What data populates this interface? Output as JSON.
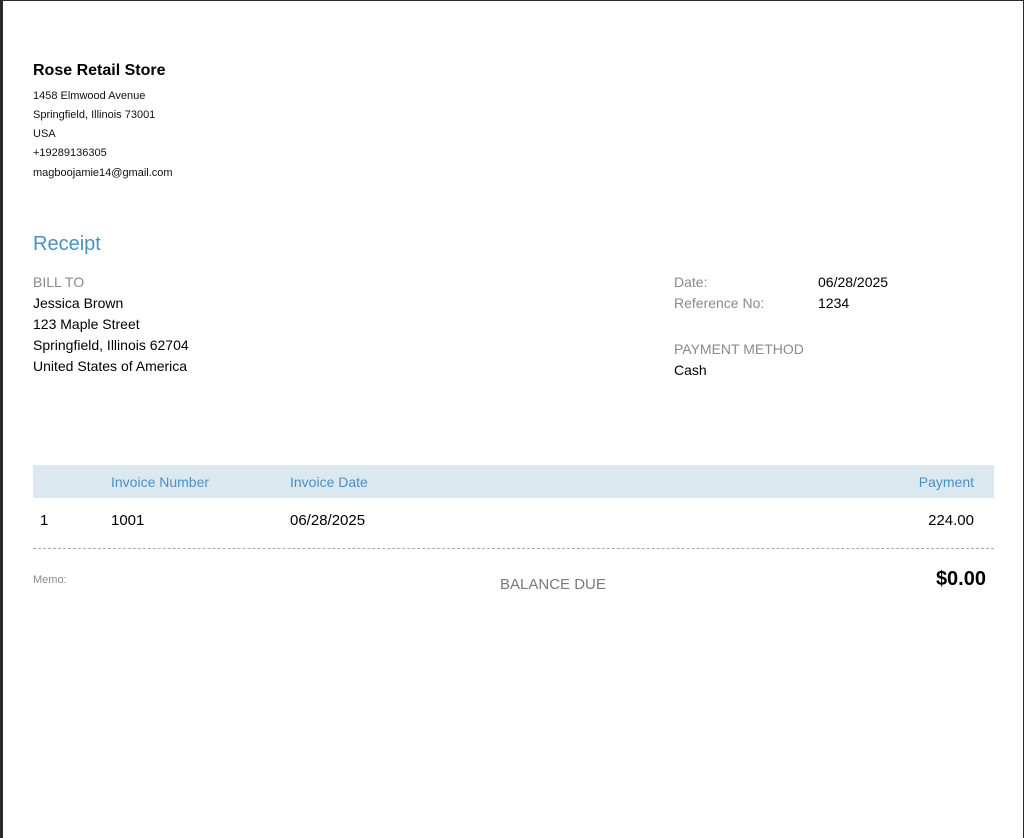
{
  "store": {
    "name": "Rose Retail Store",
    "address1": "1458 Elmwood Avenue",
    "city_state_zip": "Springfield, Illinois  73001",
    "country": "USA",
    "phone": "+19289136305",
    "email": "magboojamie14@gmail.com"
  },
  "document": {
    "title": "Receipt"
  },
  "bill_to": {
    "label": "BILL TO",
    "name": "Jessica Brown",
    "street": "123 Maple Street",
    "city_state_zip": "Springfield, Illinois  62704",
    "country": "United States of America"
  },
  "meta": {
    "date_label": "Date:",
    "date_value": "06/28/2025",
    "reference_label": "Reference No:",
    "reference_value": "1234",
    "payment_method_label": "PAYMENT METHOD",
    "payment_method_value": "Cash"
  },
  "table": {
    "headers": {
      "index": "",
      "invoice_number": "Invoice Number",
      "invoice_date": "Invoice Date",
      "payment": "Payment"
    },
    "rows": [
      {
        "index": "1",
        "invoice_number": "1001",
        "invoice_date": "06/28/2025",
        "payment": "224.00"
      }
    ]
  },
  "footer": {
    "memo_label": "Memo:",
    "balance_due_label": "BALANCE DUE",
    "balance_due_value": "$0.00"
  },
  "colors": {
    "accent": "#4a90c2",
    "header_bg": "#dce8f0",
    "muted_text": "#8a8a8a"
  }
}
